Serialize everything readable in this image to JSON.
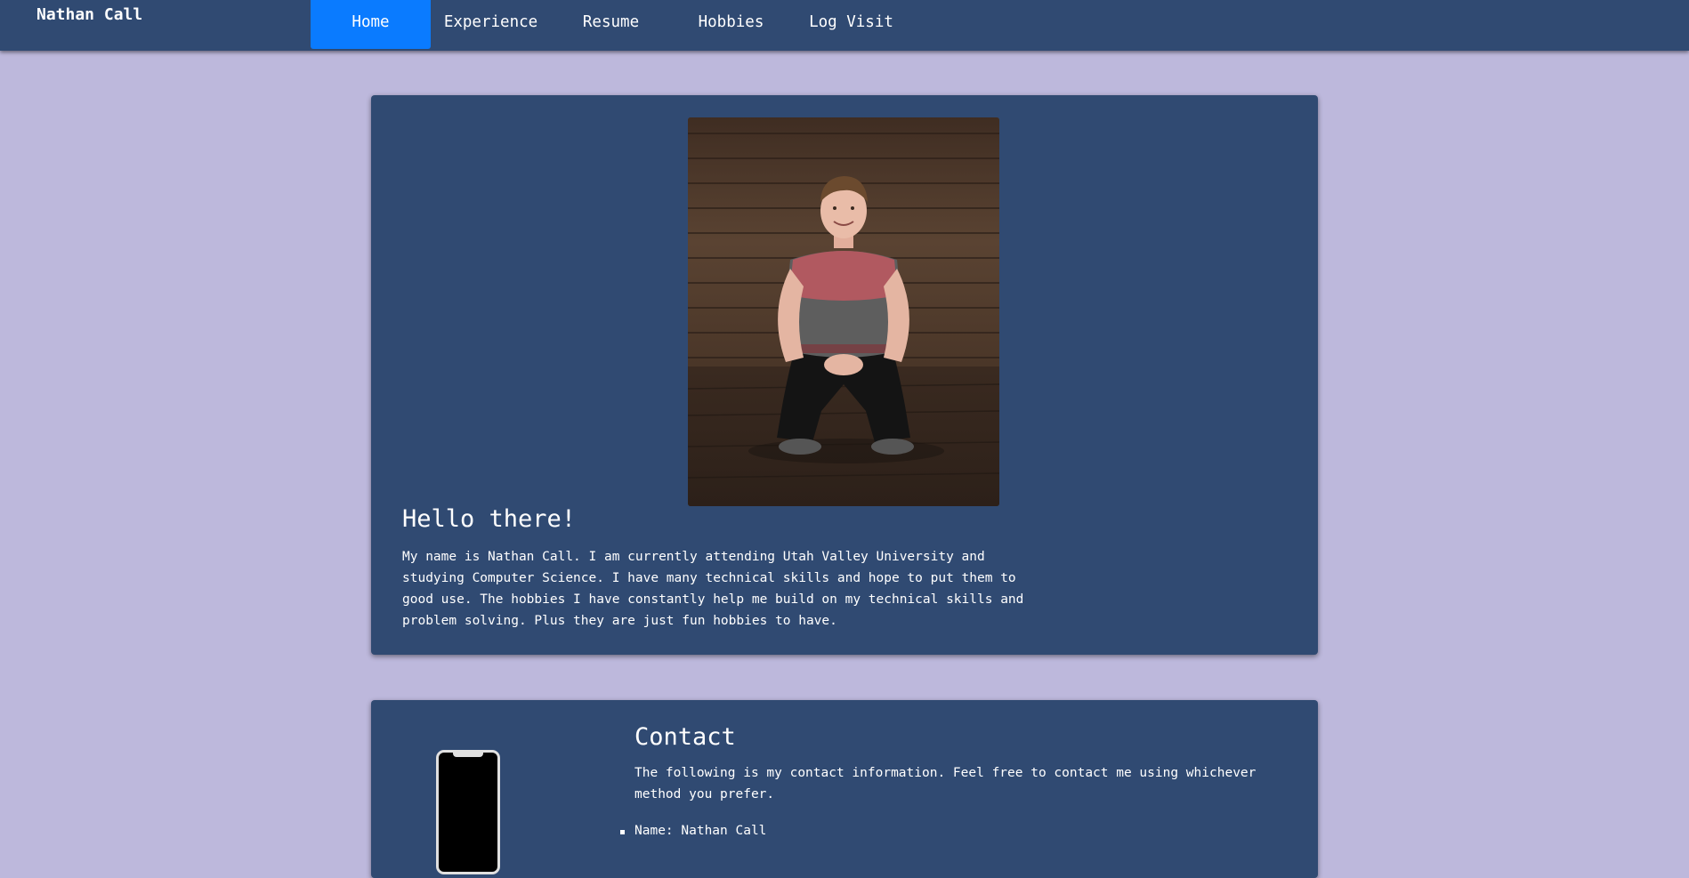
{
  "brand": "Nathan Call",
  "nav": {
    "items": [
      {
        "label": "Home",
        "active": true
      },
      {
        "label": "Experience",
        "active": false
      },
      {
        "label": "Resume",
        "active": false
      },
      {
        "label": "Hobbies",
        "active": false
      },
      {
        "label": "Log Visit",
        "active": false
      }
    ]
  },
  "hero": {
    "title": "Hello there!",
    "text": "My name is Nathan Call. I am currently attending Utah Valley University and studying Computer Science. I have many technical skills and hope to put them to good use. The hobbies I have constantly help me build on my technical skills and problem solving. Plus they are just fun hobbies to have.",
    "photo_icon": "portrait-photo"
  },
  "contact": {
    "title": "Contact",
    "text": "The following is my contact information. Feel free to contact me using whichever method you prefer.",
    "icon": "phone-icon",
    "items": [
      "Name: Nathan Call"
    ]
  },
  "colors": {
    "background": "#bdb8dc",
    "navbar": "#304a72",
    "card": "#304a72",
    "active_tab": "#0a7bff",
    "text": "#ffffff"
  }
}
